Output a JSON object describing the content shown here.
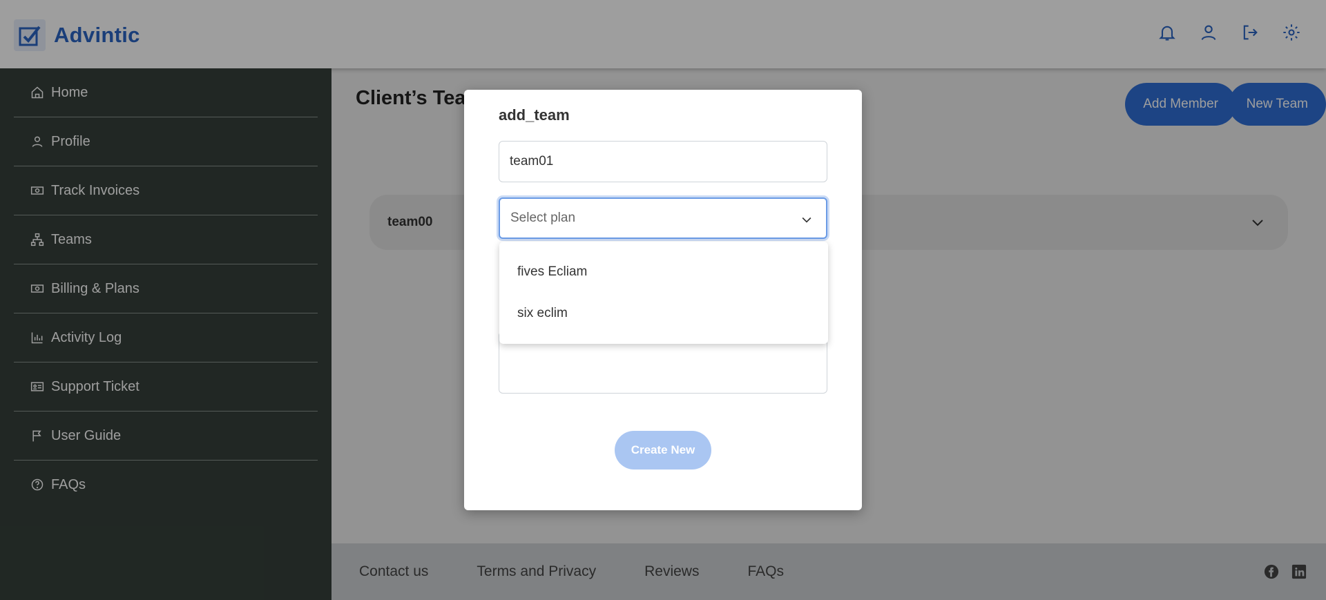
{
  "app": {
    "name": "Advintic"
  },
  "sidebar": {
    "items": [
      {
        "label": "Home",
        "icon": "home-icon"
      },
      {
        "label": "Profile",
        "icon": "user-icon"
      },
      {
        "label": "Track Invoices",
        "icon": "money-icon"
      },
      {
        "label": "Teams",
        "icon": "hierarchy-icon"
      },
      {
        "label": "Billing & Plans",
        "icon": "money-icon"
      },
      {
        "label": "Activity Log",
        "icon": "chart-icon"
      },
      {
        "label": "Support Ticket",
        "icon": "id-card-icon"
      },
      {
        "label": "User Guide",
        "icon": "flag-icon"
      },
      {
        "label": "FAQs",
        "icon": "question-icon"
      }
    ]
  },
  "main": {
    "title": "Client’s Teams",
    "add_member_label": "Add Member",
    "new_team_label": "New Team",
    "teams": [
      {
        "name": "team00"
      }
    ]
  },
  "modal": {
    "title": "add_team",
    "name_value": "team01",
    "plan_placeholder": "Select plan",
    "plan_options": [
      "fives Ecliam",
      "six eclim"
    ],
    "create_label": "Create New"
  },
  "footer": {
    "links": [
      "Contact us",
      "Terms and Privacy",
      "Reviews",
      "FAQs"
    ]
  },
  "colors": {
    "accent": "#2f6fd6",
    "sidebar": "#36403a",
    "disabled_button": "#aac6f2"
  }
}
